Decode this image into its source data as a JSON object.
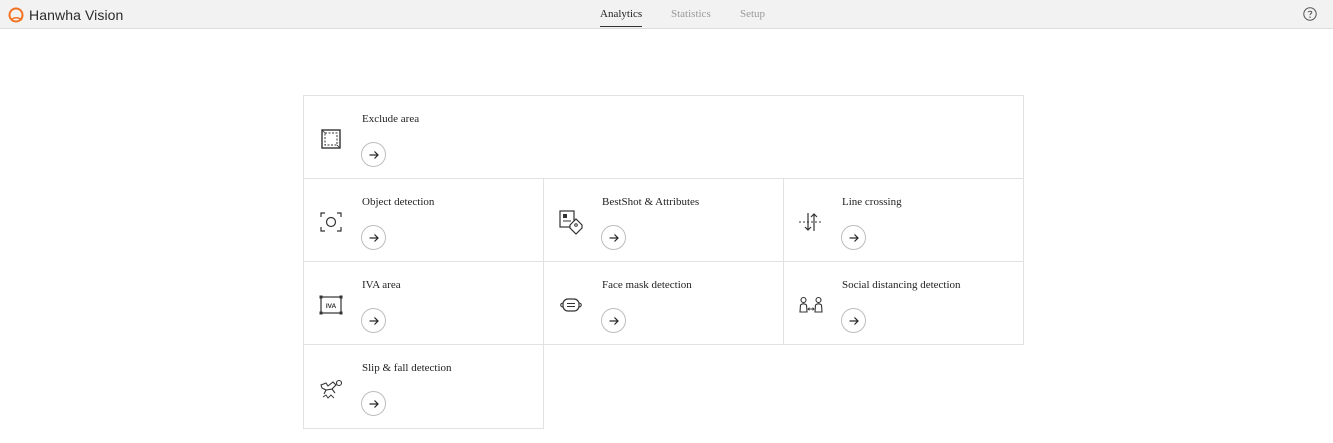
{
  "header": {
    "brand": "Hanwha Vision",
    "tabs": [
      {
        "label": "Analytics",
        "active": true
      },
      {
        "label": "Statistics",
        "active": false
      },
      {
        "label": "Setup",
        "active": false
      }
    ],
    "help_icon": "help-circle-icon"
  },
  "cards": [
    {
      "title": "Exclude area",
      "icon": "exclude-area-icon"
    },
    {
      "title": "Object detection",
      "icon": "object-detection-icon"
    },
    {
      "title": "BestShot & Attributes",
      "icon": "bestshot-icon"
    },
    {
      "title": "Line crossing",
      "icon": "line-crossing-icon"
    },
    {
      "title": "IVA area",
      "icon": "iva-area-icon",
      "icon_text": "IVA"
    },
    {
      "title": "Face mask detection",
      "icon": "face-mask-icon"
    },
    {
      "title": "Social distancing detection",
      "icon": "social-distancing-icon"
    },
    {
      "title": "Slip & fall detection",
      "icon": "slip-fall-icon"
    }
  ],
  "colors": {
    "brand_orange": "#f37321",
    "topbar_bg": "#f2f2f2"
  }
}
